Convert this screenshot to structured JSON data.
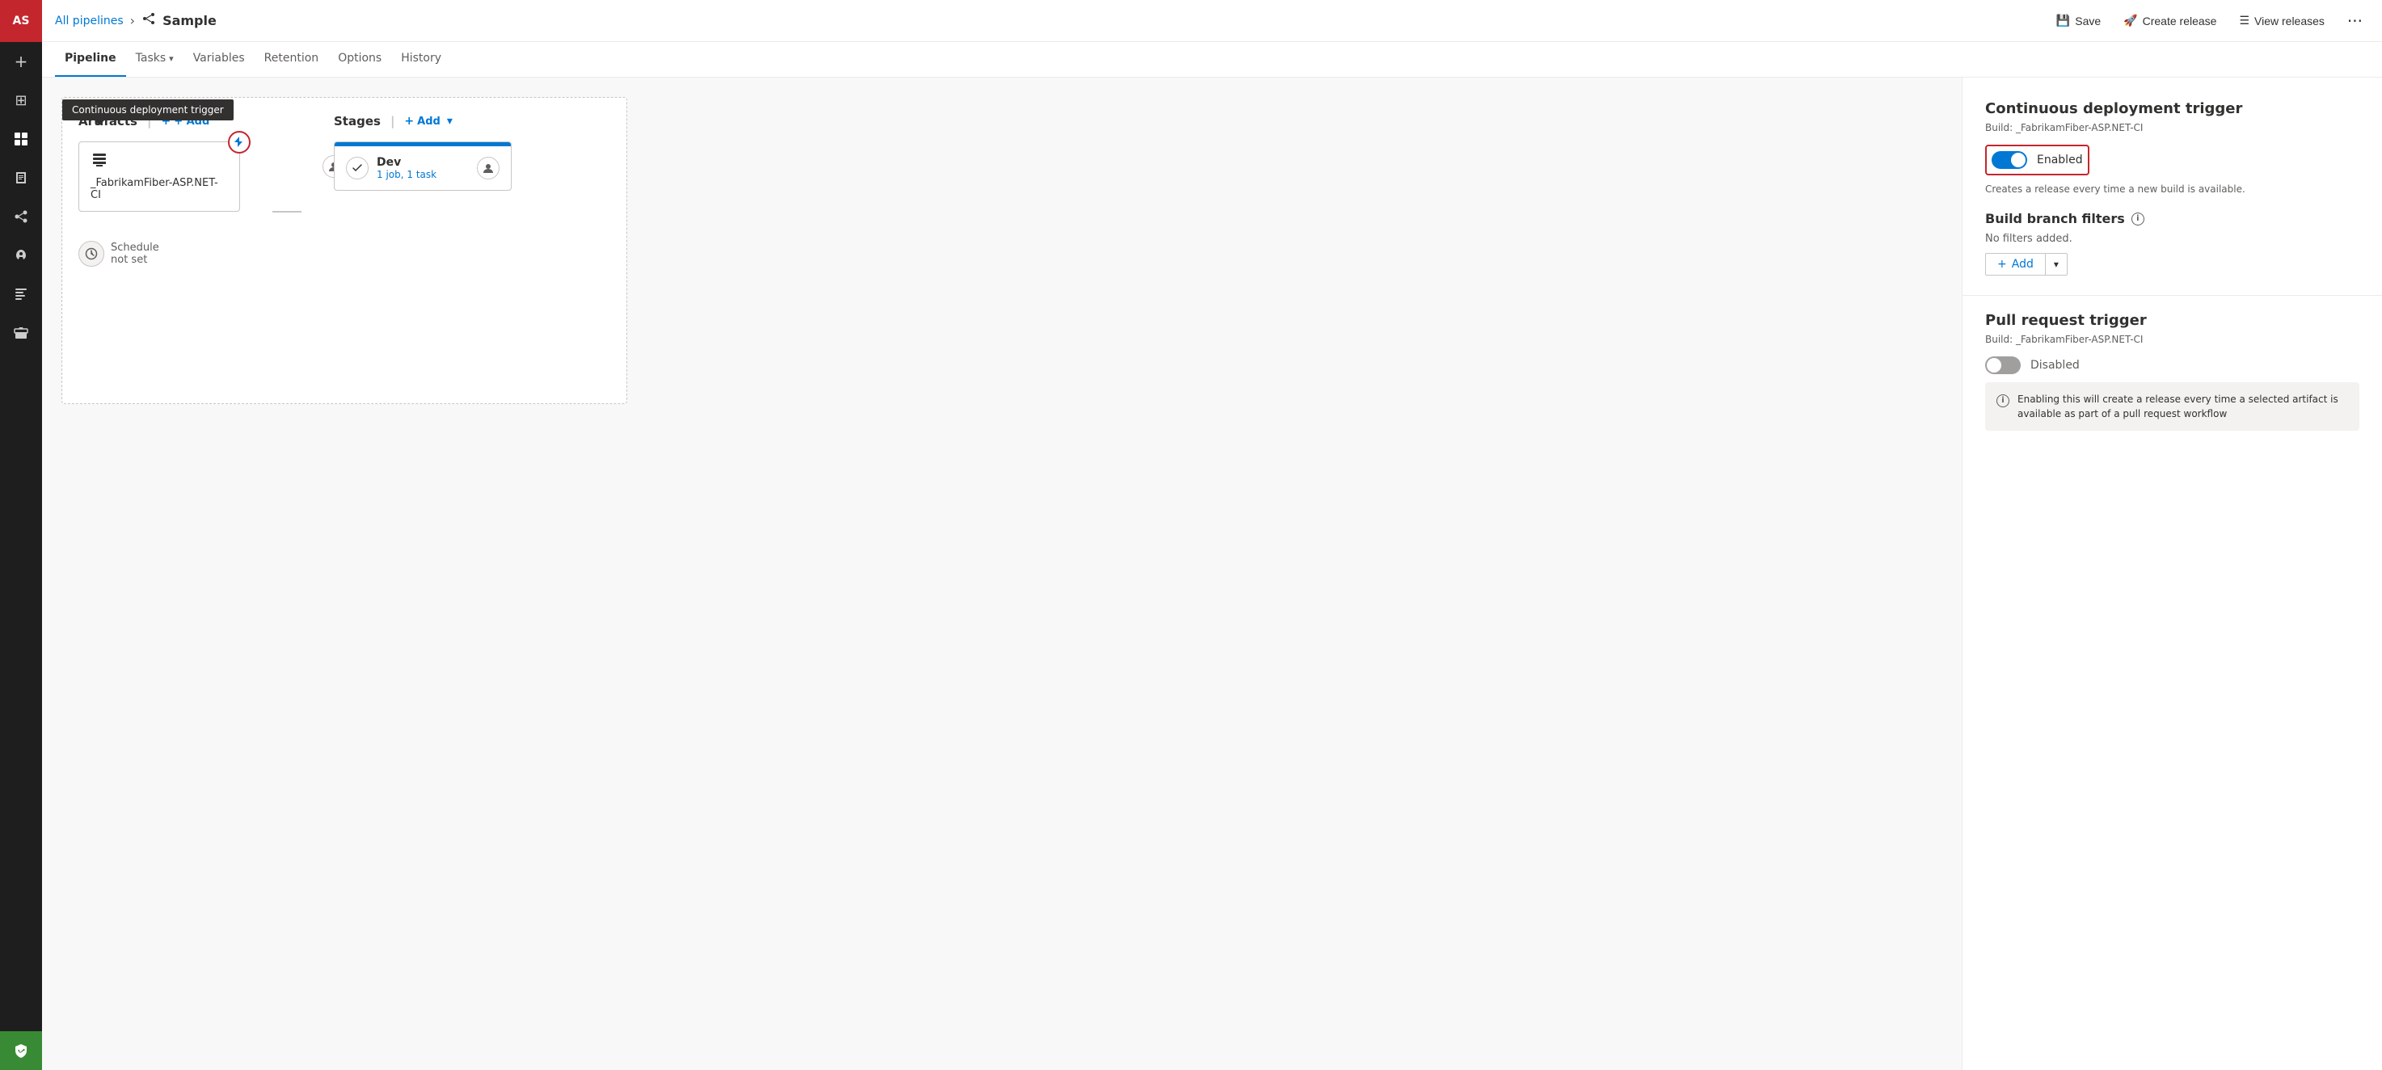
{
  "sidebar": {
    "avatar": "AS",
    "icons": [
      {
        "name": "plus-icon",
        "symbol": "+"
      },
      {
        "name": "overview-icon",
        "symbol": "⊞"
      },
      {
        "name": "boards-icon",
        "symbol": "⧉"
      },
      {
        "name": "repos-icon",
        "symbol": "↓"
      },
      {
        "name": "pipelines-icon",
        "symbol": "⚡"
      },
      {
        "name": "releases-icon",
        "symbol": "🚀"
      },
      {
        "name": "testplans-icon",
        "symbol": "☑"
      },
      {
        "name": "artifacts-icon",
        "symbol": "📦"
      },
      {
        "name": "shield-icon",
        "symbol": "🛡"
      }
    ]
  },
  "topbar": {
    "breadcrumb_link": "All pipelines",
    "breadcrumb_sep": "›",
    "pipeline_icon": "⊞",
    "title": "Sample",
    "save_label": "Save",
    "create_release_label": "Create release",
    "view_releases_label": "View releases",
    "more_symbol": "···"
  },
  "tabs": [
    {
      "id": "pipeline",
      "label": "Pipeline",
      "active": true
    },
    {
      "id": "tasks",
      "label": "Tasks",
      "has_dropdown": true
    },
    {
      "id": "variables",
      "label": "Variables"
    },
    {
      "id": "retention",
      "label": "Retention"
    },
    {
      "id": "options",
      "label": "Options"
    },
    {
      "id": "history",
      "label": "History"
    }
  ],
  "pipeline": {
    "artifacts_label": "Artifacts",
    "stages_label": "Stages",
    "add_label": "+ Add",
    "add_dropdown": "▾",
    "artifact": {
      "name": "_FabrikamFiber-ASP.NET-CI"
    },
    "trigger_tooltip": "Continuous deployment trigger",
    "schedule_label": "Schedule\nnot set",
    "stage": {
      "name": "Dev",
      "tasks": "1 job, 1 task"
    }
  },
  "right_panel": {
    "cd_trigger_title": "Continuous deployment trigger",
    "cd_build_label": "Build: _FabrikamFiber-ASP.NET-CI",
    "enabled_label": "Enabled",
    "enabled_state": true,
    "cd_desc": "Creates a release every time a new build is available.",
    "build_branch_filters_title": "Build branch filters",
    "no_filters_label": "No filters added.",
    "add_filter_label": "+ Add",
    "pr_trigger_title": "Pull request trigger",
    "pr_build_label": "Build: _FabrikamFiber-ASP.NET-CI",
    "disabled_label": "Disabled",
    "pr_enabled_state": false,
    "pr_info_text": "Enabling this will create a release every time a selected artifact is available as part of a pull request workflow"
  }
}
